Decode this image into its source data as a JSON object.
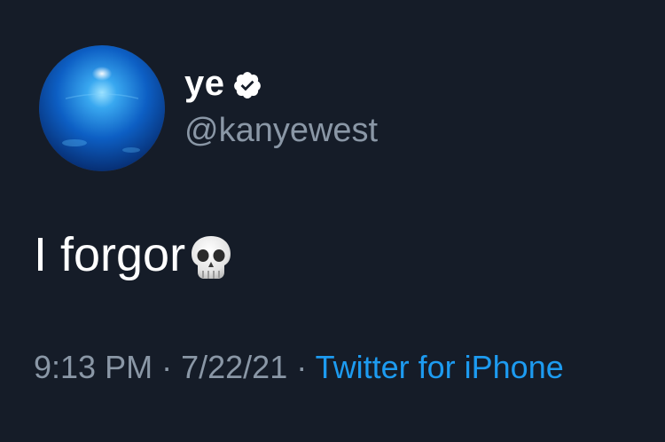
{
  "tweet": {
    "author": {
      "display_name": "ye",
      "handle": "@kanyewest",
      "verified": true,
      "avatar_icon": "blue-globe-avatar",
      "verified_icon": "verified-badge-icon"
    },
    "text": "I forgor",
    "emoji": "skull-emoji",
    "time": "9:13 PM",
    "date": "7/22/21",
    "separator": "·",
    "source": "Twitter for iPhone"
  },
  "colors": {
    "background": "#151c28",
    "text": "#ffffff",
    "secondary": "#8a97a6",
    "link": "#1d9bf0"
  }
}
